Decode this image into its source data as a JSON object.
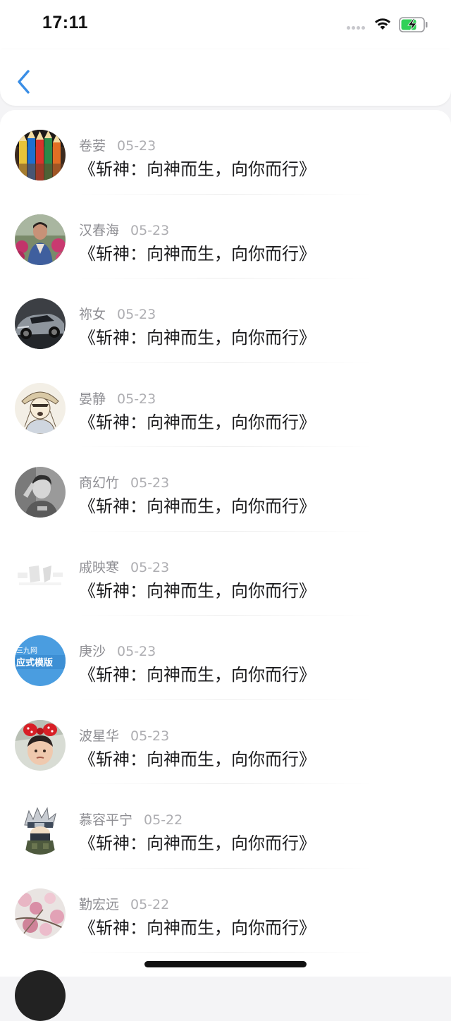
{
  "status_bar": {
    "time": "17:11",
    "battery_charging": true,
    "battery_color": "#30d158"
  },
  "nav": {
    "back_icon": "chevron-left-icon",
    "accent_color": "#3a8ee6"
  },
  "items": [
    {
      "name": "卷荌",
      "date": "05-23",
      "title": "《斩神：向神而生，向你而行》",
      "avatar": "colored-pencils"
    },
    {
      "name": "汉春海",
      "date": "05-23",
      "title": "《斩神：向神而生，向你而行》",
      "avatar": "person-flowers"
    },
    {
      "name": "祢女",
      "date": "05-23",
      "title": "《斩神：向神而生，向你而行》",
      "avatar": "sports-car"
    },
    {
      "name": "晏静",
      "date": "05-23",
      "title": "《斩神：向神而生，向你而行》",
      "avatar": "anime-sketch"
    },
    {
      "name": "商幻竹",
      "date": "05-23",
      "title": "《斩神：向神而生，向你而行》",
      "avatar": "grayscale-person"
    },
    {
      "name": "戚映寒",
      "date": "05-23",
      "title": "《斩神：向神而生，向你而行》",
      "avatar": "faded-image"
    },
    {
      "name": "庚沙",
      "date": "05-23",
      "title": "《斩神：向神而生，向你而行》",
      "avatar": "blue-template",
      "avatar_text_top": "三九网",
      "avatar_text": "应式模版"
    },
    {
      "name": "波星华",
      "date": "05-23",
      "title": "《斩神：向神而生，向你而行》",
      "avatar": "child-bow"
    },
    {
      "name": "慕容平宁",
      "date": "05-22",
      "title": "《斩神：向神而生，向你而行》",
      "avatar": "ninja-character"
    },
    {
      "name": "勤宏远",
      "date": "05-22",
      "title": "《斩神：向神而生，向你而行》",
      "avatar": "pink-blossoms"
    }
  ]
}
